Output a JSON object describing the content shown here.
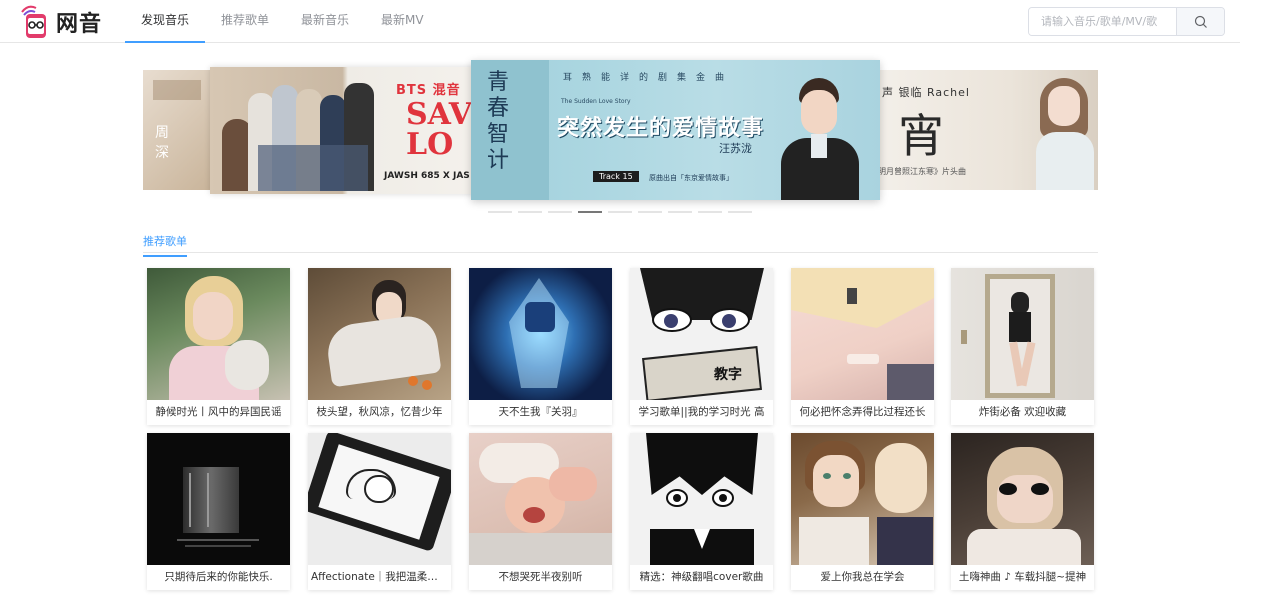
{
  "app": {
    "logo_text": "网音"
  },
  "nav": [
    {
      "label": "发现音乐",
      "active": true
    },
    {
      "label": "推荐歌单",
      "active": false
    },
    {
      "label": "最新音乐",
      "active": false
    },
    {
      "label": "最新MV",
      "active": false
    }
  ],
  "search": {
    "placeholder": "请输入音乐/歌单/MV/歌",
    "value": ""
  },
  "carousel": {
    "slides": [
      {
        "texts": [
          "周",
          "深"
        ]
      },
      {
        "texts": [
          "BTS 混音",
          "SAV",
          "LO",
          "JAWSH 685 X JAS"
        ]
      },
      {
        "texts": [
          "耳熟能详的剧集金曲",
          "突然发生的爱情故事",
          "汪苏泷",
          "Track 15",
          "原曲出自「东京爱情故事」",
          "The Sudden Love Story"
        ]
      },
      {
        "texts": [
          "声 银临 Rachel",
          "宵",
          "明月曾照江东寒》片头曲"
        ]
      }
    ],
    "dot_count": 9,
    "active_dot": 3
  },
  "section": {
    "title": "推荐歌单"
  },
  "playlists": [
    {
      "title": "静候时光丨风中的异国民谣"
    },
    {
      "title": "枝头望，秋风凉，忆昔少年"
    },
    {
      "title": "天不生我『关羽』"
    },
    {
      "title": "学习歌单||我的学习时光 高"
    },
    {
      "title": "何必把怀念弄得比过程还长"
    },
    {
      "title": "炸街必备 欢迎收藏"
    },
    {
      "title": "只期待后来的你能快乐."
    },
    {
      "title": "Affectionate｜我把温柔设置"
    },
    {
      "title": "不想哭死半夜别听"
    },
    {
      "title": "精选：神级翻唱cover歌曲"
    },
    {
      "title": "爱上你我总在学会"
    },
    {
      "title": "土嗨神曲 ♪ 车载抖腿~提神"
    }
  ],
  "colors": {
    "accent": "#409eff"
  }
}
